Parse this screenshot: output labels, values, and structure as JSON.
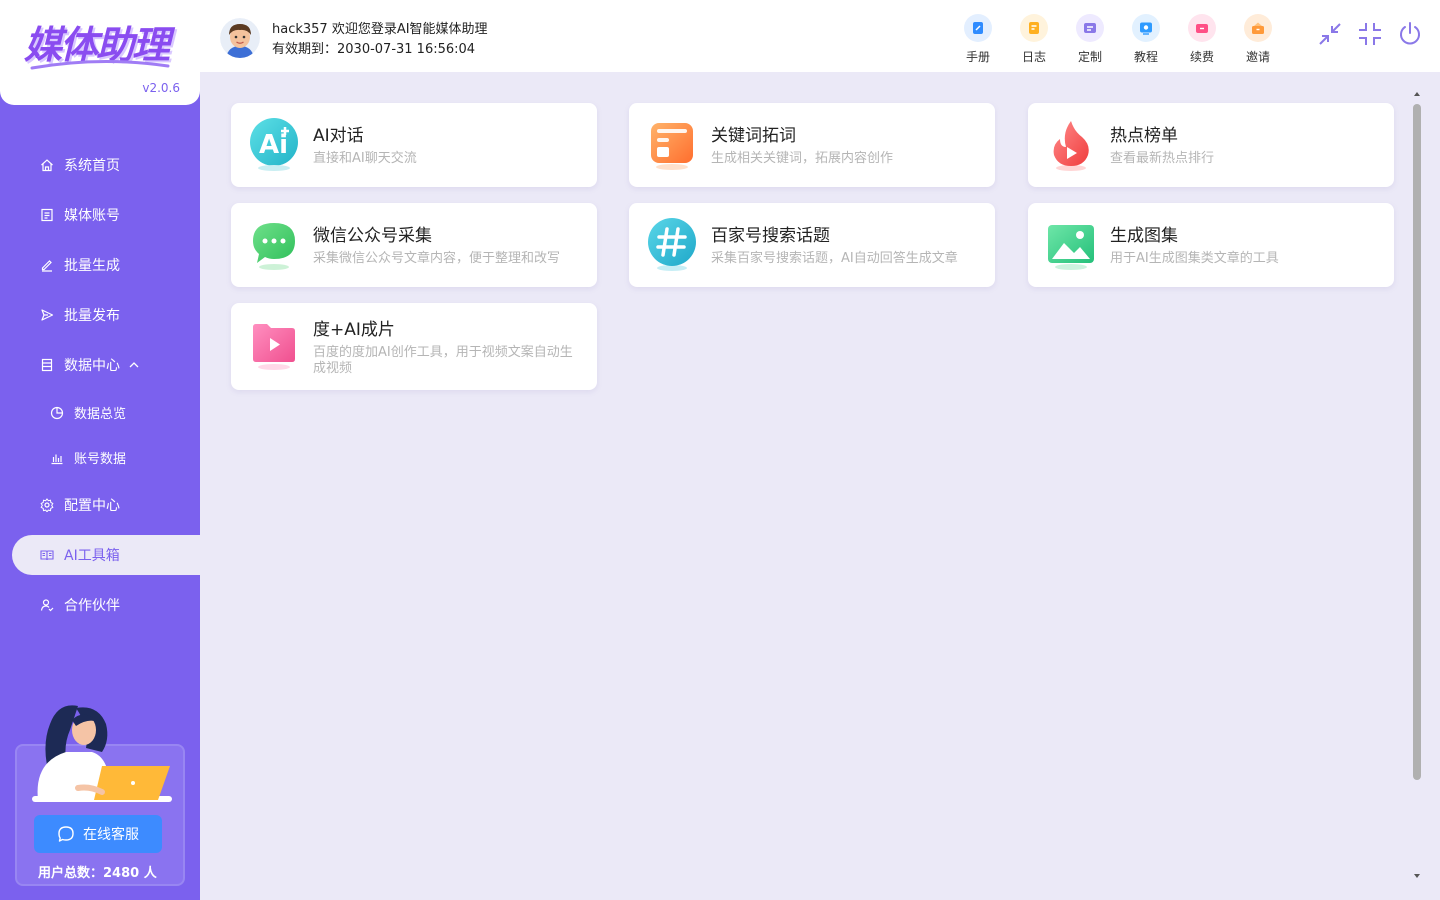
{
  "app": {
    "logo_text": "媒体助理",
    "version": "v2.0.6"
  },
  "header": {
    "greeting": "hack357 欢迎您登录AI智能媒体助理",
    "expire": "有效期到：2030-07-31 16:56:04",
    "tools": [
      {
        "label": "手册",
        "icon": "manual-icon",
        "color": "#2f8cff"
      },
      {
        "label": "日志",
        "icon": "log-icon",
        "color": "#ffb020"
      },
      {
        "label": "定制",
        "icon": "custom-icon",
        "color": "#8a78e8"
      },
      {
        "label": "教程",
        "icon": "tutorial-icon",
        "color": "#2f9bff"
      },
      {
        "label": "续费",
        "icon": "renew-icon",
        "color": "#ff4f86"
      },
      {
        "label": "邀请",
        "icon": "invite-icon",
        "color": "#ff9a3a"
      }
    ]
  },
  "sidebar": {
    "items": [
      {
        "label": "系统首页",
        "icon": "home-icon"
      },
      {
        "label": "媒体账号",
        "icon": "account-icon"
      },
      {
        "label": "批量生成",
        "icon": "edit-icon"
      },
      {
        "label": "批量发布",
        "icon": "send-icon"
      },
      {
        "label": "数据中心",
        "icon": "data-icon"
      },
      {
        "label": "数据总览",
        "icon": "pie-icon"
      },
      {
        "label": "账号数据",
        "icon": "bar-chart-icon"
      },
      {
        "label": "配置中心",
        "icon": "gear-icon"
      },
      {
        "label": "AI工具箱",
        "icon": "book-icon"
      },
      {
        "label": "合作伙伴",
        "icon": "partner-icon"
      }
    ],
    "support_label": "在线客服",
    "user_count": "用户总数：2480 人"
  },
  "cards": [
    {
      "title": "AI对话",
      "desc": "直接和AI聊天交流",
      "icon": "ai-chat-icon"
    },
    {
      "title": "关键词拓词",
      "desc": "生成相关关键词，拓展内容创作",
      "icon": "keyword-icon"
    },
    {
      "title": "热点榜单",
      "desc": "查看最新热点排行",
      "icon": "hot-icon"
    },
    {
      "title": "微信公众号采集",
      "desc": "采集微信公众号文章内容，便于整理和改写",
      "icon": "wechat-icon"
    },
    {
      "title": "百家号搜索话题",
      "desc": "采集百家号搜索话题，AI自动回答生成文章",
      "icon": "hashtag-icon"
    },
    {
      "title": "生成图集",
      "desc": "用于AI生成图集类文章的工具",
      "icon": "gallery-icon"
    },
    {
      "title": "度+AI成片",
      "desc": "百度的度加AI创作工具，用于视频文案自动生成视频",
      "icon": "video-icon"
    }
  ]
}
